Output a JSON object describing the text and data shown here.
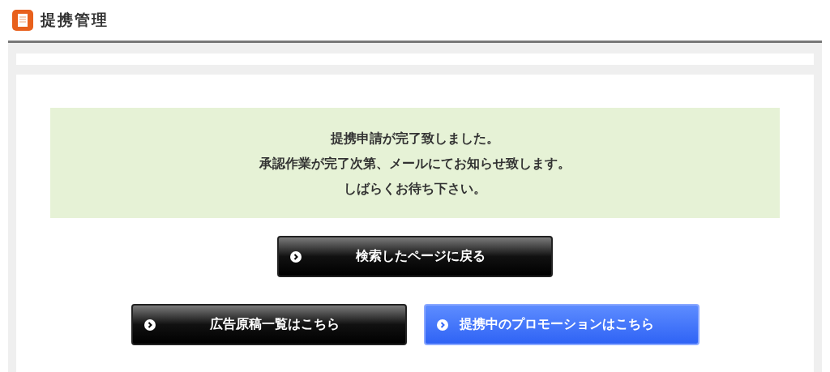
{
  "header": {
    "title": "提携管理"
  },
  "message": {
    "lines": [
      "提携申請が完了致しました。",
      "承認作業が完了次第、メールにてお知らせ致します。",
      "しばらくお待ち下さい。"
    ]
  },
  "button_rows": [
    [
      {
        "label": "検索したページに戻る",
        "kind": "dark"
      }
    ],
    [
      {
        "label": "広告原稿一覧はこちら",
        "kind": "dark"
      },
      {
        "label": "提携中のプロモーションはこちら",
        "kind": "blue"
      }
    ]
  ]
}
